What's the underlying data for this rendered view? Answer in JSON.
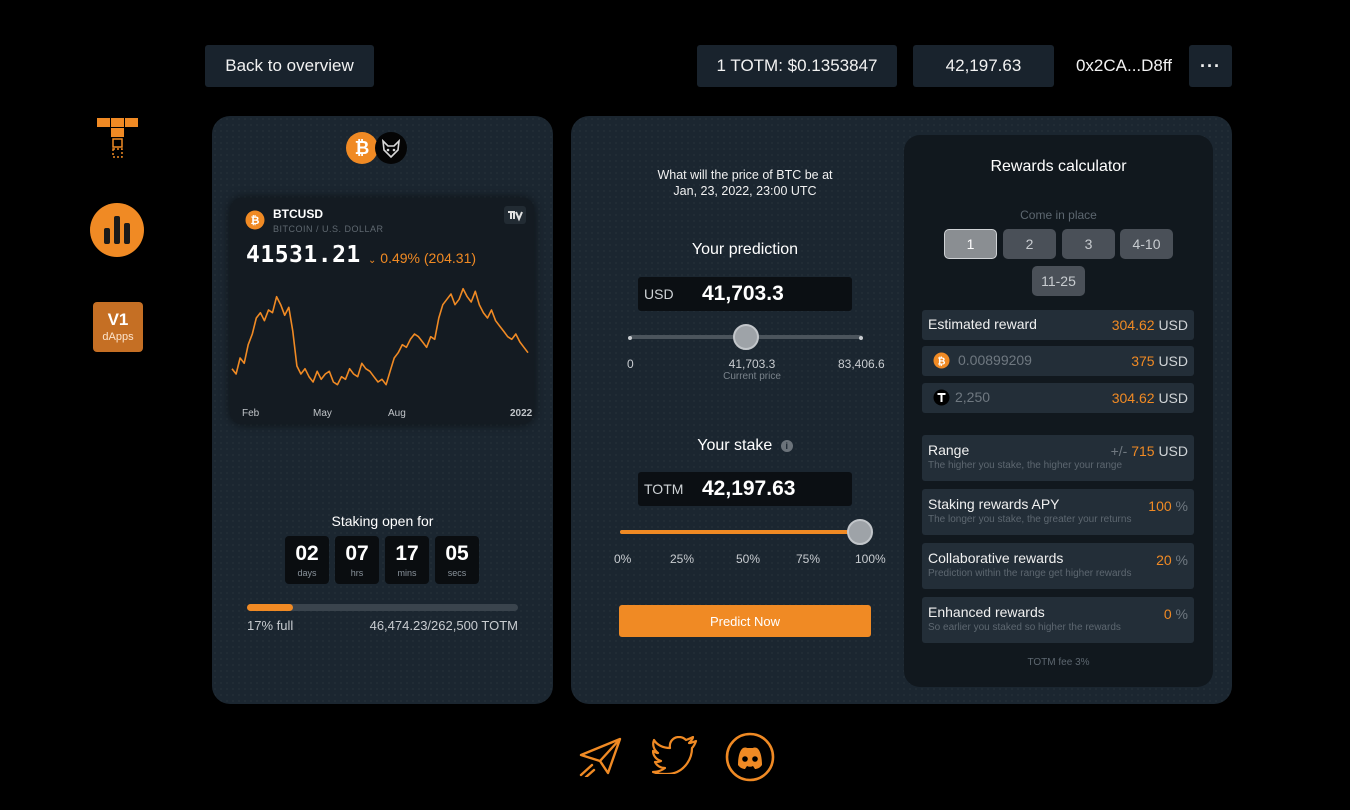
{
  "header": {
    "back_label": "Back to overview",
    "price_label": "1 TOTM: $0.1353847",
    "balance": "42,197.63",
    "wallet": "0x2CA...D8ff",
    "more_label": "···"
  },
  "sidebar": {
    "v1_label": "V1",
    "dapps_label": "dApps"
  },
  "chart_widget": {
    "symbol": "BTCUSD",
    "subtitle": "BITCOIN / U.S. DOLLAR",
    "price": "41531.21",
    "change": "0.49% (204.31)",
    "x_labels": [
      "Feb",
      "May",
      "Aug",
      "2022"
    ]
  },
  "chart_data": {
    "type": "line",
    "x_labels": [
      "Feb",
      "May",
      "Aug",
      "2022"
    ],
    "values": [
      36,
      34,
      40,
      38,
      45,
      49,
      55,
      57,
      54,
      58,
      57,
      63,
      60,
      56,
      59,
      50,
      37,
      34,
      36,
      33,
      31,
      35,
      32,
      34,
      35,
      31,
      30,
      33,
      32,
      36,
      34,
      33,
      38,
      36,
      35,
      33,
      31,
      32,
      30,
      35,
      40,
      42,
      45,
      44,
      47,
      49,
      48,
      46,
      44,
      48,
      47,
      55,
      60,
      62,
      64,
      60,
      62,
      66,
      63,
      61,
      65,
      60,
      57,
      55,
      58,
      54,
      52,
      50,
      48,
      47,
      49,
      46,
      44,
      42
    ]
  },
  "staking": {
    "title": "Staking open for",
    "countdown": [
      {
        "num": "02",
        "unit": "days"
      },
      {
        "num": "07",
        "unit": "hrs"
      },
      {
        "num": "17",
        "unit": "mins"
      },
      {
        "num": "05",
        "unit": "secs"
      }
    ],
    "progress_fraction": 0.17,
    "full_label": "17% full",
    "amount_label": "46,474.23/262,500 TOTM"
  },
  "prediction": {
    "question_line1": "What will the price of BTC be at",
    "question_line2": "Jan, 23, 2022, 23:00 UTC",
    "title": "Your prediction",
    "currency": "USD",
    "value": "41,703.3",
    "slider_fraction": 0.5,
    "min_label": "0",
    "mid_value": "41,703.3",
    "mid_label": "Current price",
    "max_label": "83,406.6"
  },
  "stake": {
    "title": "Your stake",
    "currency": "TOTM",
    "value": "42,197.63",
    "slider_fraction": 1.0,
    "ticks": [
      "0%",
      "25%",
      "50%",
      "75%",
      "100%"
    ],
    "predict_label": "Predict Now"
  },
  "rewards": {
    "title": "Rewards calculator",
    "place_label": "Come in place",
    "places": [
      "1",
      "2",
      "3",
      "4-10",
      "11-25"
    ],
    "estimated_label": "Estimated reward",
    "estimated_value": "304.62",
    "estimated_unit": "USD",
    "btc_amount": "0.00899209",
    "btc_value": "375",
    "btc_unit": "USD",
    "totm_amount": "2,250",
    "totm_value": "304.62",
    "totm_unit": "USD",
    "range_label": "Range",
    "range_sub": "The higher you stake, the higher your range",
    "range_prefix": "+/-",
    "range_value": "715",
    "range_unit": "USD",
    "apy_label": "Staking rewards APY",
    "apy_sub": "The longer you stake, the greater your returns",
    "apy_value": "100",
    "collab_label": "Collaborative rewards",
    "collab_sub": "Prediction within the range get higher rewards",
    "collab_value": "20",
    "enhanced_label": "Enhanced rewards",
    "enhanced_sub": "So earlier you staked so higher the rewards",
    "enhanced_value": "0",
    "percent_sign": "%",
    "fee_label": "TOTM fee 3%"
  },
  "colors": {
    "accent": "#f08a24",
    "card": "#1b2630",
    "background": "#000000"
  }
}
